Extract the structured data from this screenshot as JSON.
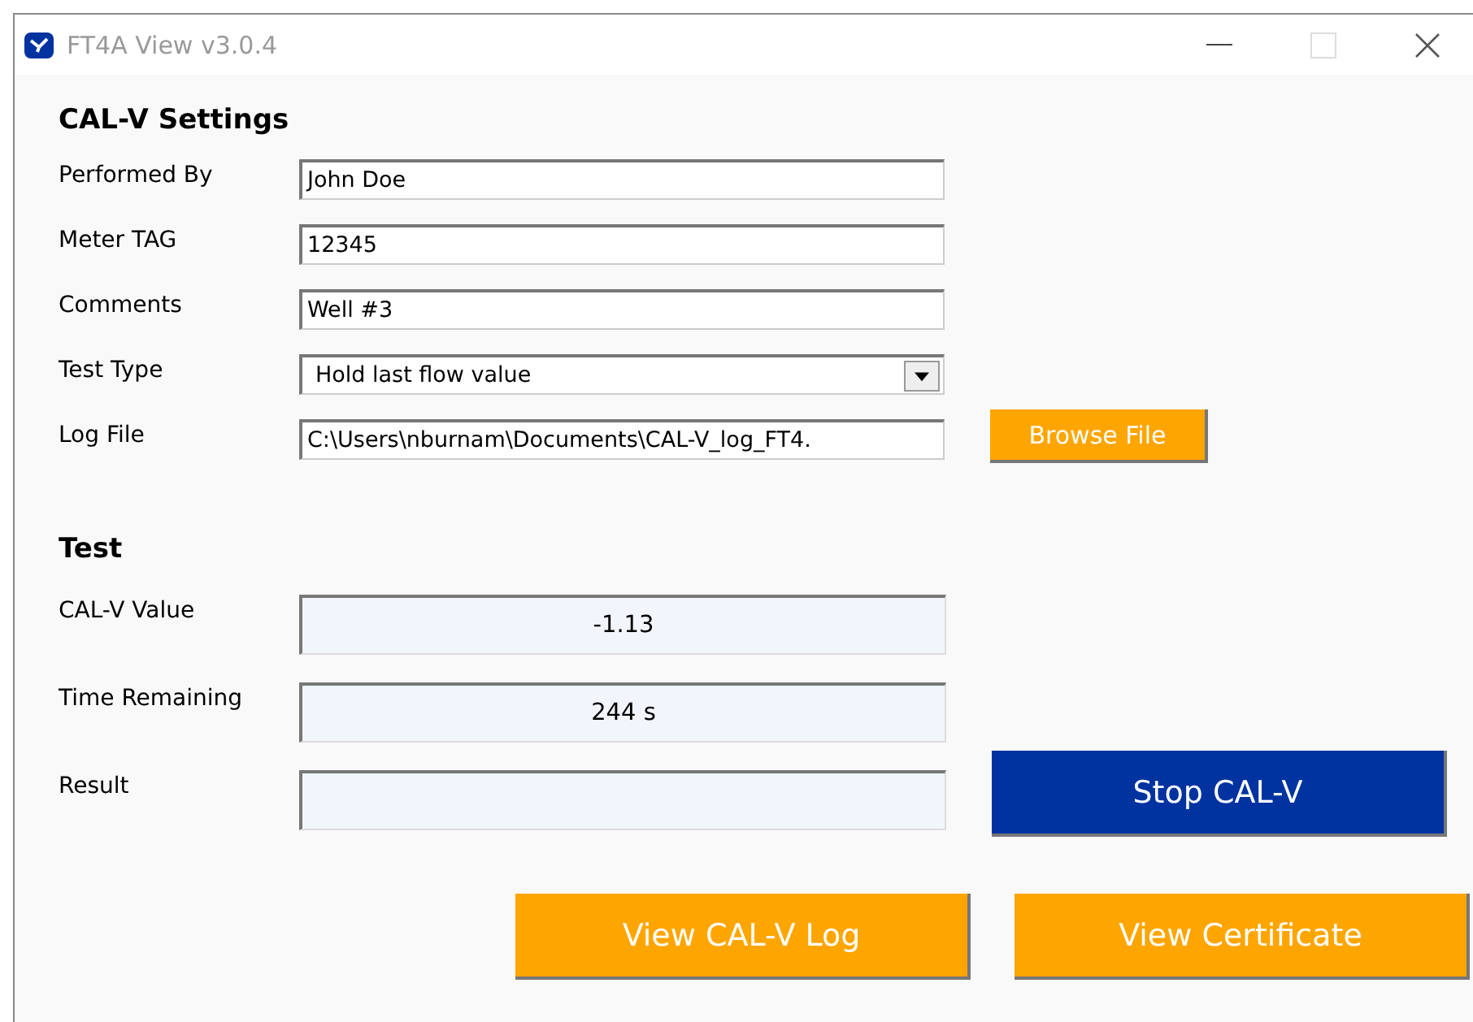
{
  "window": {
    "title": "FT4A View v3.0.4"
  },
  "settings": {
    "heading": "CAL-V Settings",
    "fields": [
      {
        "kind": "text",
        "label": "Performed By",
        "value": "John Doe"
      },
      {
        "kind": "text",
        "label": "Meter TAG",
        "value": "12345"
      },
      {
        "kind": "text",
        "label": "Comments",
        "value": "Well #3"
      },
      {
        "kind": "dropdown",
        "label": "Test Type",
        "value": "Hold last flow value"
      },
      {
        "kind": "file",
        "label": "Log File",
        "value": "C:\\Users\\nburnam\\Documents\\CAL-V_log_FT4.",
        "button": "Browse File"
      }
    ]
  },
  "test": {
    "heading": "Test",
    "readouts": [
      {
        "label": "CAL-V Value",
        "value": "-1.13"
      },
      {
        "label": "Time Remaining",
        "value": "244 s"
      },
      {
        "label": "Result"
      }
    ],
    "stop_button": "Stop CAL-V",
    "buttons": [
      "View CAL-V Log",
      "View Certificate"
    ]
  }
}
